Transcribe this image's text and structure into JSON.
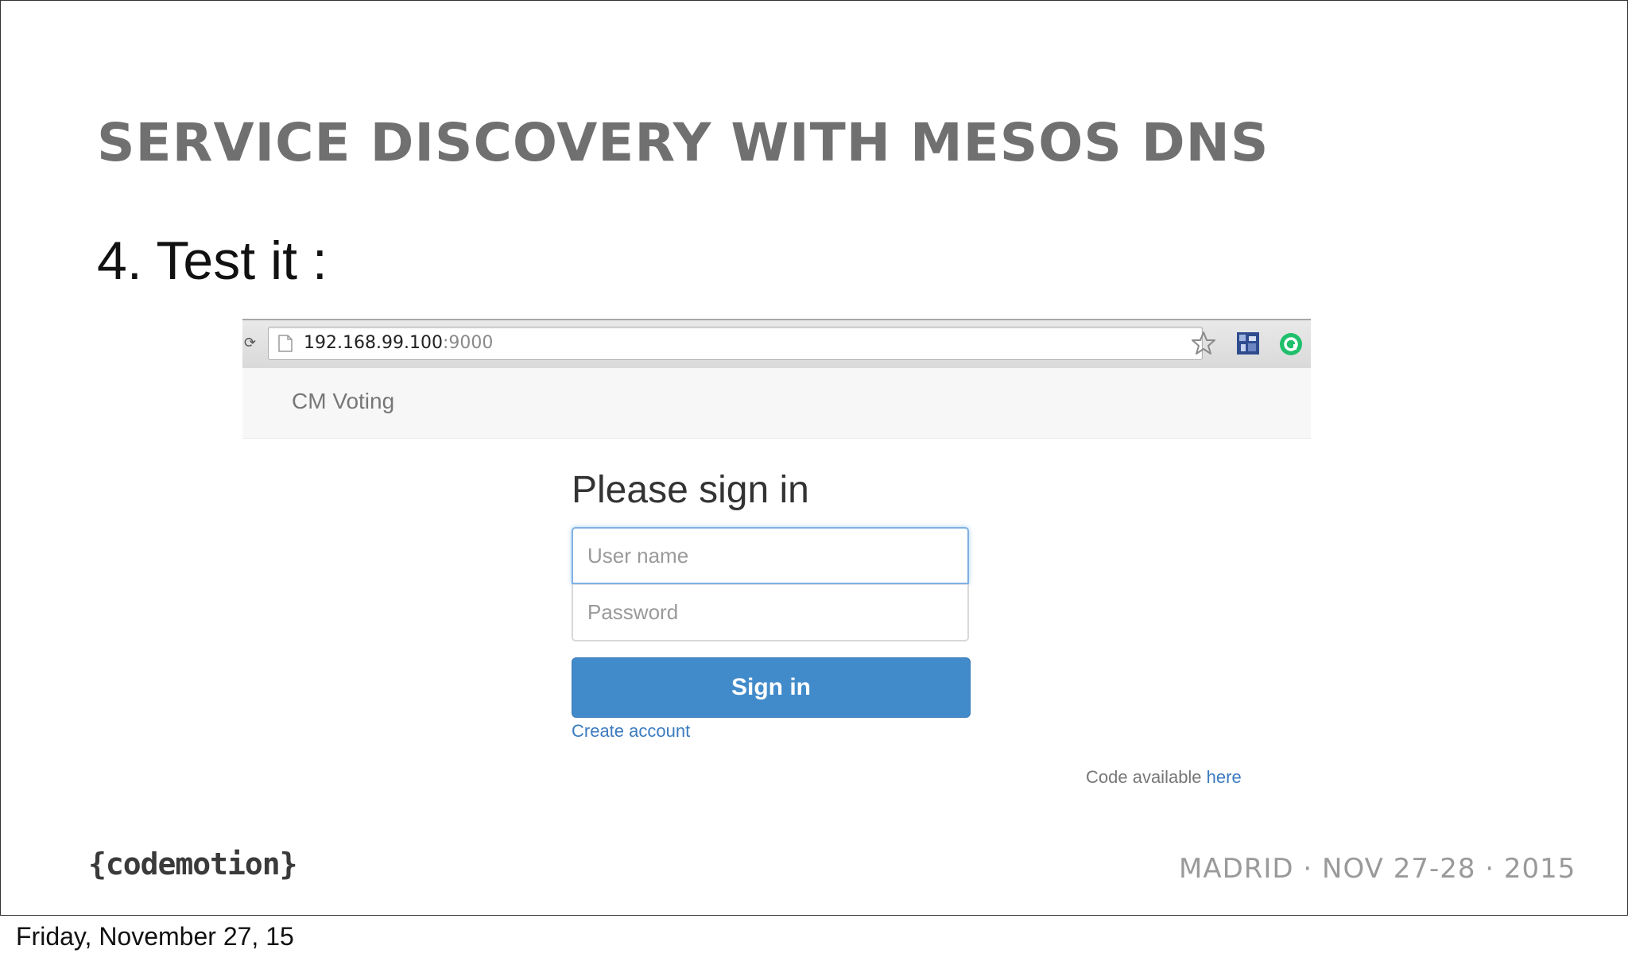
{
  "slide": {
    "title": "SERVICE DISCOVERY WITH MESOS DNS",
    "step": "4. Test it :"
  },
  "browser": {
    "url_host": "192.168.99.100",
    "url_port": ":9000",
    "icons": [
      "page-icon",
      "star-icon",
      "extension-icon",
      "green-circle-icon"
    ]
  },
  "app": {
    "brand": "CM Voting",
    "heading": "Please sign in",
    "username_placeholder": "User name",
    "password_placeholder": "Password",
    "signin_label": "Sign in",
    "create_account_label": "Create account",
    "code_note_prefix": "Code available",
    "code_note_link": "here"
  },
  "footer": {
    "logo_text": "{codemotion}",
    "event": "MADRID · NOV 27-28 · 2015"
  },
  "caption": {
    "date": "Friday, November 27, 15"
  },
  "colors": {
    "title": "#707070",
    "button": "#428bca",
    "link": "#3b7bbf",
    "focus_border": "#7fb1e3"
  }
}
